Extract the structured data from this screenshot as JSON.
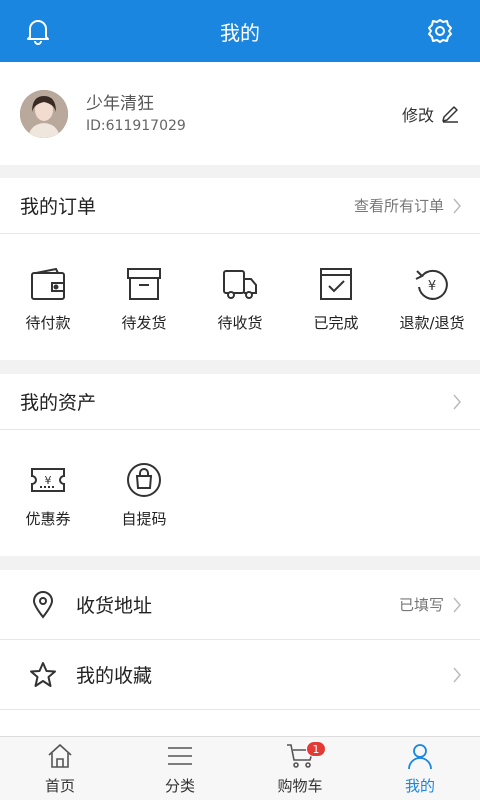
{
  "header": {
    "title": "我的",
    "left_icon": "bell-icon",
    "right_icon": "gear-icon"
  },
  "profile": {
    "name": "少年清狂",
    "id_text": "ID:611917029",
    "edit_label": "修改"
  },
  "orders": {
    "title": "我的订单",
    "view_all": "查看所有订单",
    "items": [
      {
        "label": "待付款",
        "icon": "wallet-icon"
      },
      {
        "label": "待发货",
        "icon": "box-icon"
      },
      {
        "label": "待收货",
        "icon": "truck-icon"
      },
      {
        "label": "已完成",
        "icon": "checkbox-icon"
      },
      {
        "label": "退款/退货",
        "icon": "refund-icon"
      }
    ]
  },
  "assets": {
    "title": "我的资产",
    "items": [
      {
        "label": "优惠券",
        "icon": "coupon-icon"
      },
      {
        "label": "自提码",
        "icon": "pickup-bag-icon"
      }
    ]
  },
  "list": [
    {
      "label": "收货地址",
      "right": "已填写",
      "icon": "location-pin-icon"
    },
    {
      "label": "我的收藏",
      "right": "",
      "icon": "star-icon"
    }
  ],
  "tabbar": {
    "items": [
      {
        "label": "首页",
        "icon": "home-icon"
      },
      {
        "label": "分类",
        "icon": "menu-lines-icon"
      },
      {
        "label": "购物车",
        "icon": "cart-icon",
        "badge": "1"
      },
      {
        "label": "我的",
        "icon": "user-icon",
        "active": true
      }
    ],
    "active_color": "#1b86e0"
  },
  "colors": {
    "primary": "#1b86e0",
    "badge": "#e53935"
  }
}
